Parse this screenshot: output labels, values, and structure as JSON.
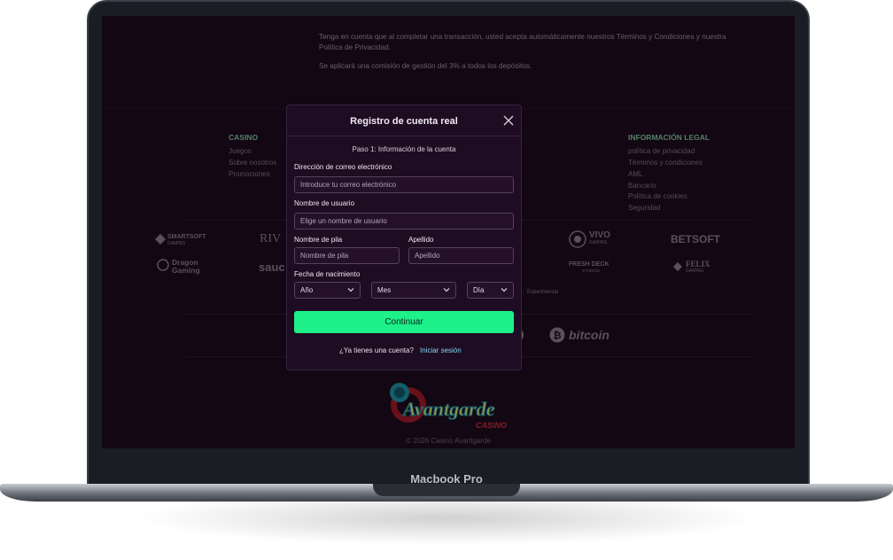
{
  "device": {
    "brand": "Macbook Pro"
  },
  "page": {
    "notice_line1": "Tenga en cuenta que al completar una transacción, usted acepta automáticamente nuestros Términos y Condiciones y nuestra",
    "notice_line2": "Política de Privacidad.",
    "fee_notice": "Se aplicará una comisión de gestión del 3% a todos los depósitos.",
    "footer": {
      "casino_title": "CASINO",
      "casino_links": [
        "Juegos",
        "Sobre nosotros",
        "Promociones"
      ],
      "legal_title": "INFORMACIÓN LEGAL",
      "legal_links": [
        "política de privacidad",
        "Términos y condiciones",
        "AML",
        "Bancario",
        "Política de cookies",
        "Seguridad"
      ]
    },
    "providers": {
      "smartsoft_1": "SMARTSOFT",
      "smartsoft_2": "GAMING",
      "rival": "RIV",
      "dragon_1": "Dragon",
      "dragon_2": "Gaming",
      "saucify": "sauc",
      "vivo_1": "VIVO",
      "vivo_2": "GAMING",
      "betsoft": "BETSOFT",
      "freshdeck_1": "FRESH DECK",
      "freshdeck_2": "STUDIOS",
      "felix_1": "FELIX",
      "felix_2": "GAMING",
      "experimental": "Experimental"
    },
    "payments": {
      "bitcoin": "bitcoin"
    },
    "logo": {
      "main": "Avantgarde",
      "sub": "CASINO"
    },
    "copyright": "© 2026 Casino Avantgarde"
  },
  "modal": {
    "title": "Registro de cuenta real",
    "step": "Paso 1: Información de la cuenta",
    "email_label": "Dirección de correo electrónico",
    "email_placeholder": "Introduce tu correo electrónico",
    "username_label": "Nombre de usuario",
    "username_placeholder": "Elige un nombre de usuario",
    "firstname_label": "Nombre de pila",
    "firstname_placeholder": "Nombre de pila",
    "lastname_label": "Apellido",
    "lastname_placeholder": "Apellido",
    "dob_label": "Fecha de nacimiento",
    "year_value": "Año",
    "month_value": "Mes",
    "day_value": "Día",
    "continue_label": "Continuar",
    "login_question": "¿Ya tienes una cuenta?",
    "login_link": "Iniciar sesión"
  }
}
